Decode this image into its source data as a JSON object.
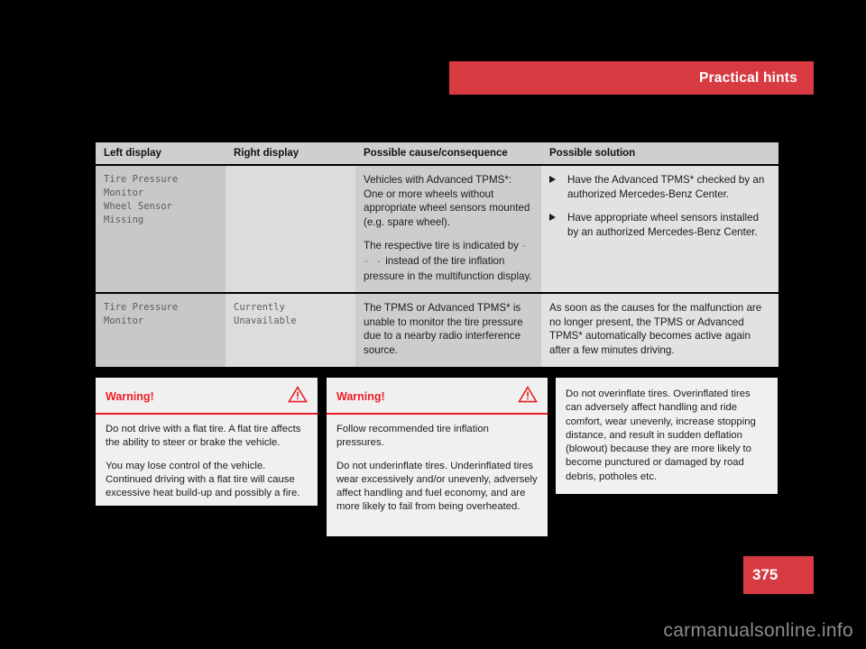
{
  "header": {
    "title": "Practical hints",
    "accent_color": "#d83a42"
  },
  "table": {
    "columns": [
      "Left display",
      "Right display",
      "Possible cause/consequence",
      "Possible solution"
    ],
    "rows": [
      {
        "left_display": "Tire Pressure Monitor\nWheel Sensor Missing",
        "right_display": "",
        "cause_p1": "Vehicles with Advanced TPMS*: One or more wheels without appropriate wheel sensors mounted (e.g. spare wheel).",
        "cause_p2_pre": "The respective tire is indicated by",
        "cause_p2_dashes": "- - -",
        "cause_p2_post": "instead of the tire inflation pressure in the multifunction display.",
        "solutions": [
          "Have the Advanced TPMS* checked by an authorized Mercedes-Benz Center.",
          "Have appropriate wheel sensors installed by an authorized Mercedes-Benz Center."
        ]
      },
      {
        "left_display": "Tire Pressure Monitor",
        "right_display": "Currently\nUnavailable",
        "cause_p1": "The TPMS or Advanced TPMS* is unable to monitor the tire pressure due to a nearby radio interference source.",
        "solution_text": "As soon as the causes for the malfunction are no longer present, the TPMS or Advanced TPMS* automatically becomes active again after a few minutes driving."
      }
    ]
  },
  "warning_boxes": [
    {
      "label": "Warning!",
      "icon": "warning-triangle-icon",
      "paragraphs": [
        "Do not drive with a flat tire. A flat tire affects the ability to steer or brake the vehicle.",
        "You may lose control of the vehicle. Continued driving with a flat tire will cause excessive heat build-up and possibly a fire."
      ]
    },
    {
      "label": "Warning!",
      "icon": "warning-triangle-icon",
      "paragraphs": [
        "Follow recommended tire inflation pressures.",
        "Do not underinflate tires. Underinflated tires wear excessively and/or unevenly, adversely affect handling and fuel economy, and are more likely to fail from being overheated."
      ]
    },
    {
      "label": "",
      "icon": "",
      "paragraphs": [
        "Do not overinflate tires. Overinflated tires can adversely affect handling and ride comfort, wear unevenly, increase stopping distance, and result in sudden deflation (blowout) because they are more likely to become punctured or damaged by road debris, potholes etc."
      ]
    }
  ],
  "page": {
    "number": "375"
  },
  "watermark": {
    "text": "carmanualsonline.info"
  }
}
